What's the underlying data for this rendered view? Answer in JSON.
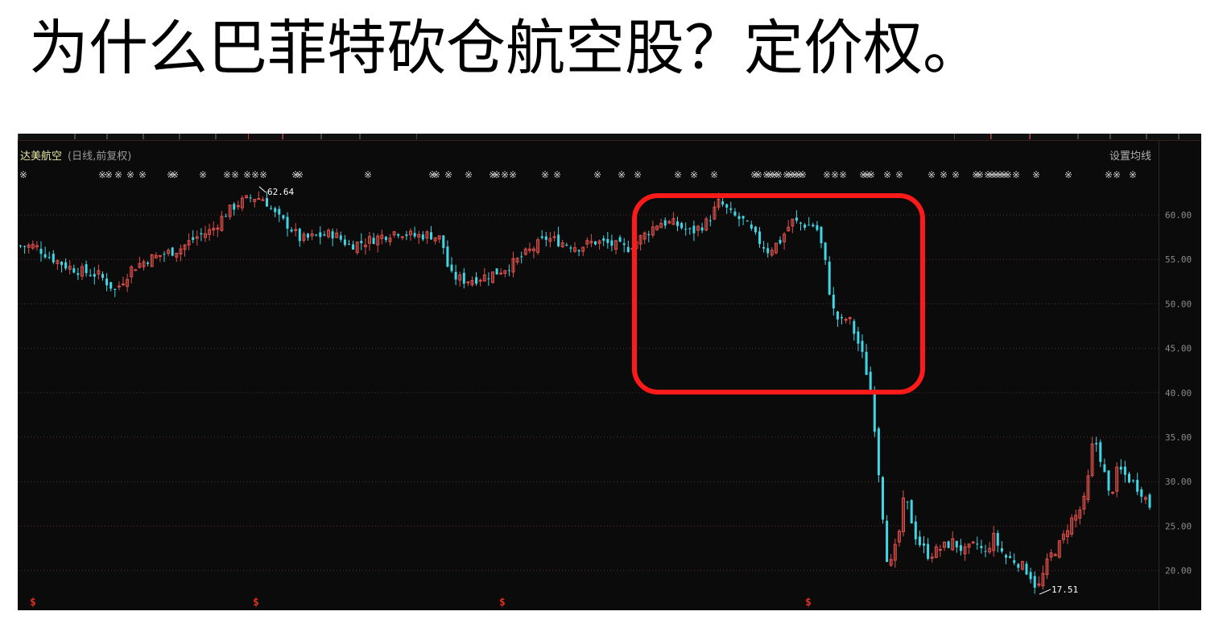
{
  "title": "为什么巴菲特砍仓航空股？定价权。",
  "panel": {
    "stock_name": "达美航空",
    "period_label": "(日线,前复权)",
    "ma_setting": "设置均线",
    "event_glyph": "※",
    "dividend_glyph": "$"
  },
  "colors": {
    "up": "#e0504b",
    "down": "#3fd6e6",
    "grid": "#5a3030",
    "highlight": "#ff1a1a",
    "background": "#0b0b0b"
  },
  "chart_data": {
    "type": "candlestick",
    "ylim": [
      17,
      66
    ],
    "y_ticks": [
      20,
      25,
      30,
      35,
      40,
      45,
      50,
      55,
      60
    ],
    "y_tick_labels": [
      "20.00",
      "25.00",
      "30.00",
      "35.00",
      "40.00",
      "45.00",
      "50.00",
      "55.00",
      "60.00"
    ],
    "grid": true,
    "high_marker": {
      "value": 62.64,
      "label": "62.64"
    },
    "low_marker": {
      "value": 17.51,
      "label": "17.51"
    },
    "close_path": [
      [
        0,
        56.5
      ],
      [
        20,
        56.5
      ],
      [
        40,
        55.2
      ],
      [
        60,
        54.2
      ],
      [
        80,
        53.6
      ],
      [
        100,
        53.2
      ],
      [
        120,
        51.5
      ],
      [
        140,
        54.0
      ],
      [
        160,
        55.0
      ],
      [
        180,
        55.6
      ],
      [
        200,
        56.2
      ],
      [
        220,
        57.5
      ],
      [
        240,
        58.3
      ],
      [
        255,
        60.0
      ],
      [
        270,
        61.2
      ],
      [
        290,
        62.0
      ],
      [
        305,
        61.8
      ],
      [
        320,
        59.8
      ],
      [
        335,
        58.8
      ],
      [
        350,
        57.2
      ],
      [
        370,
        57.6
      ],
      [
        390,
        57.9
      ],
      [
        410,
        56.6
      ],
      [
        430,
        57.0
      ],
      [
        450,
        57.6
      ],
      [
        470,
        58.2
      ],
      [
        490,
        57.6
      ],
      [
        510,
        57.8
      ],
      [
        525,
        57.3
      ],
      [
        535,
        53.2
      ],
      [
        555,
        52.6
      ],
      [
        575,
        53.0
      ],
      [
        595,
        53.6
      ],
      [
        615,
        54.6
      ],
      [
        635,
        56.0
      ],
      [
        655,
        57.4
      ],
      [
        675,
        56.9
      ],
      [
        695,
        56.4
      ],
      [
        715,
        57.0
      ],
      [
        735,
        56.7
      ],
      [
        755,
        56.2
      ],
      [
        775,
        57.6
      ],
      [
        795,
        59.2
      ],
      [
        815,
        59.0
      ],
      [
        835,
        58.0
      ],
      [
        855,
        59.2
      ],
      [
        870,
        61.5
      ],
      [
        885,
        60.0
      ],
      [
        900,
        59.3
      ],
      [
        915,
        57.5
      ],
      [
        930,
        56.0
      ],
      [
        945,
        57.0
      ],
      [
        960,
        59.3
      ],
      [
        975,
        58.9
      ],
      [
        990,
        58.8
      ],
      [
        1000,
        55.5
      ],
      [
        1010,
        49.5
      ],
      [
        1020,
        47.8
      ],
      [
        1030,
        48.5
      ],
      [
        1040,
        46.2
      ],
      [
        1050,
        43.5
      ],
      [
        1060,
        39.0
      ],
      [
        1070,
        29.0
      ],
      [
        1080,
        19.8
      ],
      [
        1092,
        23.5
      ],
      [
        1100,
        28.5
      ],
      [
        1115,
        23.5
      ],
      [
        1130,
        21.7
      ],
      [
        1145,
        22.5
      ],
      [
        1160,
        23.2
      ],
      [
        1175,
        22.1
      ],
      [
        1190,
        23.0
      ],
      [
        1200,
        21.8
      ],
      [
        1210,
        23.8
      ],
      [
        1225,
        21.5
      ],
      [
        1240,
        21.0
      ],
      [
        1255,
        19.7
      ],
      [
        1265,
        17.8
      ],
      [
        1280,
        21.5
      ],
      [
        1295,
        23.2
      ],
      [
        1305,
        25.5
      ],
      [
        1315,
        26.3
      ],
      [
        1325,
        28.2
      ],
      [
        1335,
        35.2
      ],
      [
        1345,
        32.2
      ],
      [
        1355,
        28.0
      ],
      [
        1365,
        31.5
      ],
      [
        1375,
        30.6
      ],
      [
        1385,
        29.8
      ],
      [
        1395,
        28.8
      ],
      [
        1405,
        27.2
      ]
    ],
    "event_marker_positions": [
      2,
      100,
      108,
      120,
      135,
      150,
      185,
      190,
      225,
      255,
      265,
      280,
      290,
      300,
      340,
      345,
      430,
      510,
      515,
      530,
      555,
      585,
      590,
      600,
      610,
      650,
      665,
      715,
      745,
      765,
      815,
      835,
      860,
      910,
      915,
      925,
      930,
      935,
      940,
      950,
      955,
      960,
      965,
      970,
      1000,
      1010,
      1020,
      1045,
      1050,
      1055,
      1075,
      1090,
      1130,
      1145,
      1160,
      1185,
      1190,
      1200,
      1205,
      1210,
      1215,
      1220,
      1225,
      1235,
      1260,
      1300,
      1350,
      1360,
      1380
    ],
    "dividend_marker_positions": [
      15,
      292,
      598,
      978
    ],
    "highlight_region": {
      "x_start": 763,
      "x_end": 1128,
      "y_high": 63,
      "y_low": 40
    }
  }
}
